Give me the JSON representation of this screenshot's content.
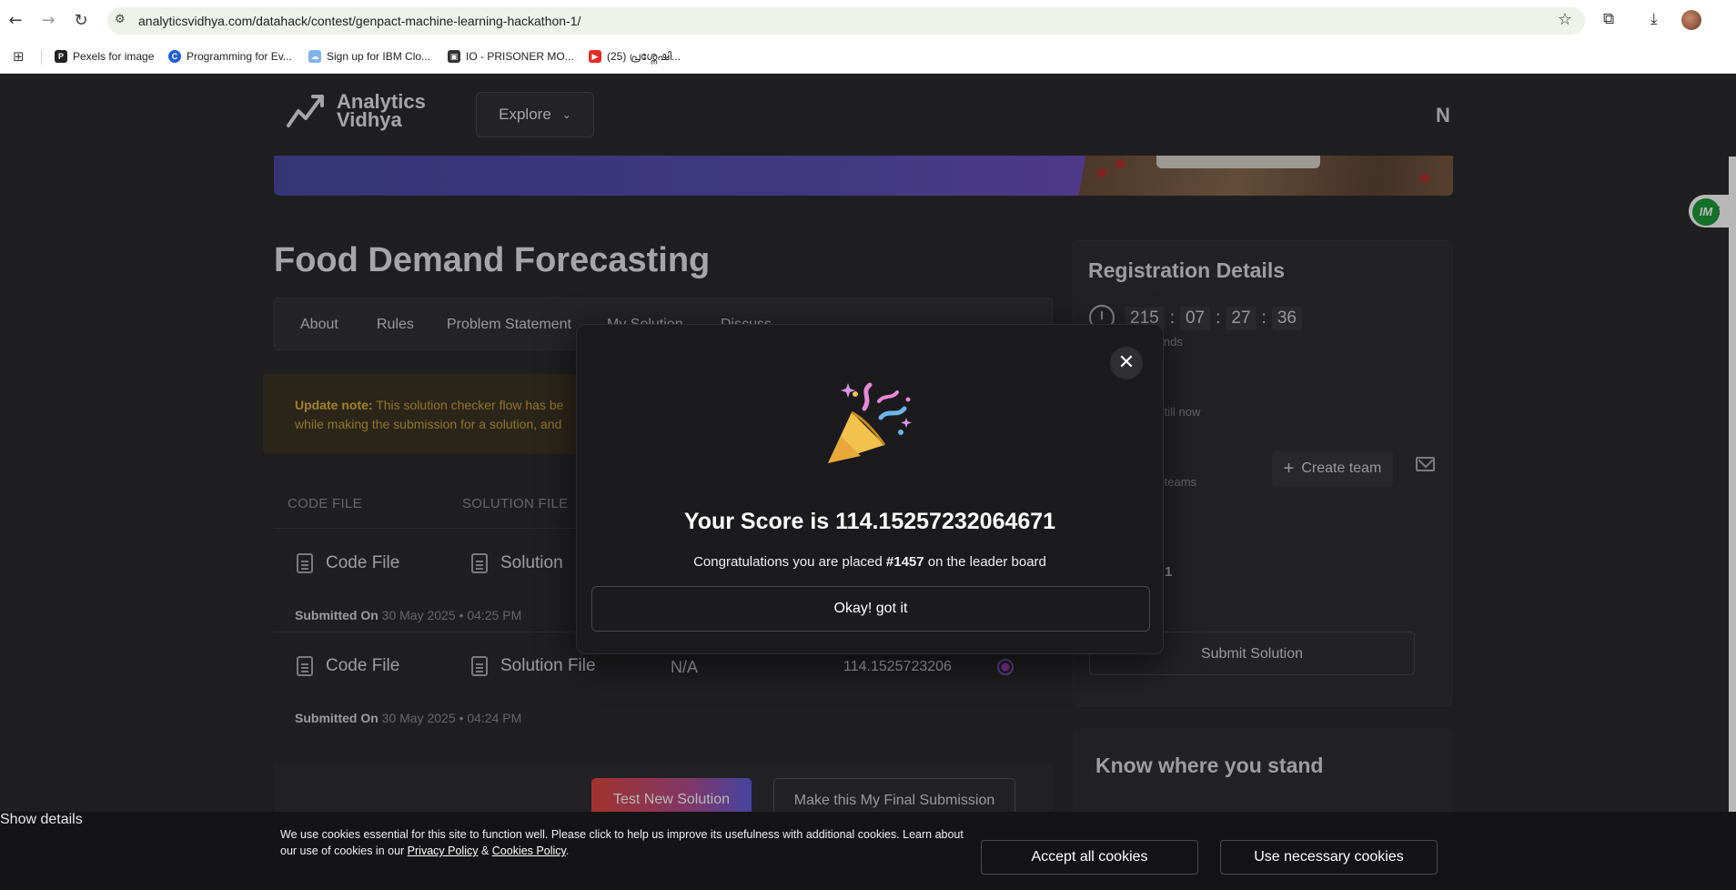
{
  "browser": {
    "url": "analyticsvidhya.com/datahack/contest/genpact-machine-learning-hackathon-1/",
    "bookmarks": [
      {
        "label": "Pexels for image"
      },
      {
        "label": "Programming for Ev..."
      },
      {
        "label": "Sign up for IBM Clo..."
      },
      {
        "label": "IO - PRISONER MO..."
      },
      {
        "label": "(25) പ്രശ്നേഷി..."
      }
    ]
  },
  "header": {
    "logo_line1": "Analytics",
    "logo_line2": "Vidhya",
    "explore_label": "Explore",
    "avatar_letter": "N"
  },
  "page": {
    "title": "Food Demand Forecasting",
    "tabs": [
      {
        "label": "About"
      },
      {
        "label": "Rules"
      },
      {
        "label": "Problem Statement"
      },
      {
        "label": "My Solution"
      },
      {
        "label": "Discuss"
      }
    ],
    "update_note_label": "Update note:",
    "update_note_line1": " This solution checker flow has be",
    "update_note_line2": "while making the submission for a solution, and",
    "columns": {
      "code": "CODE FILE",
      "solution": "SOLUTION FILE"
    },
    "submissions": [
      {
        "code": "Code File",
        "solution": "Solution",
        "submitted_label": "Submitted On",
        "date": "30 May 2025",
        "time": "04:25 PM"
      },
      {
        "code": "Code File",
        "solution": "Solution File",
        "na": "N/A",
        "score": "114.1525723206",
        "submitted_label": "Submitted On",
        "date": "30 May 2025",
        "time": "04:24 PM"
      }
    ],
    "test_button": "Test New Solution",
    "final_button": "Make this My Final Submission"
  },
  "registration": {
    "title": "Registration Details",
    "timer": [
      "215",
      "07",
      "27",
      "36"
    ],
    "timer_label": "ent ends",
    "registered_label": "ered till now",
    "teams_label": "er of teams",
    "create_team": "Create team",
    "partial_value": "1",
    "submit_solution": "Submit Solution"
  },
  "know": {
    "title": "Know where you stand"
  },
  "modal": {
    "score_text": "Your Score is 114.15257232064671",
    "congrats_prefix": "Congratulations you are placed ",
    "rank": "#1457",
    "congrats_suffix": " on the leader board",
    "ok_button": "Okay! got it"
  },
  "cookie": {
    "message_part1": "We use cookies essential for this site to function well. Please click to help us improve its usefulness with additional cookies. Learn about our use of cookies in our ",
    "privacy_link": "Privacy Policy",
    "amp": " & ",
    "cookies_link": "Cookies Policy",
    "period": ".",
    "show_details": "Show details",
    "accept_all": "Accept all cookies",
    "use_necessary": "Use necessary cookies"
  },
  "widget": {
    "badge": "IM"
  },
  "colors": {
    "page_bg": "#2b2a2d",
    "accent_gradient_start": "#e0473f",
    "accent_gradient_end": "#5f5ee0",
    "note_text": "#c9a23a",
    "badge_green": "#1e9c3a"
  },
  "icons": [
    "back-arrow-icon",
    "forward-arrow-icon",
    "reload-icon",
    "site-settings-icon",
    "star-icon",
    "extensions-icon",
    "download-icon",
    "apps-grid-icon",
    "chevron-down-icon",
    "clock-icon",
    "plus-icon",
    "mail-icon",
    "document-icon",
    "close-icon",
    "party-popper-icon"
  ]
}
